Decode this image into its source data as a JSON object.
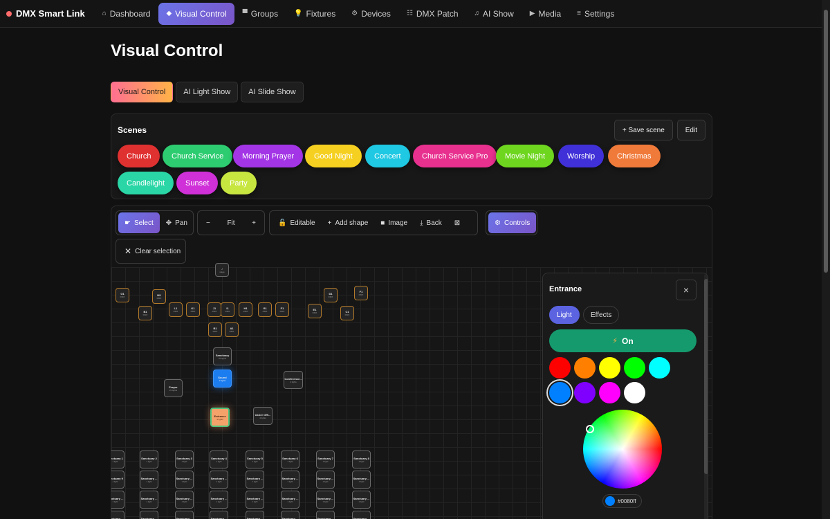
{
  "app": {
    "name": "DMX Smart Link"
  },
  "nav": [
    {
      "label": "Dashboard",
      "icon": "home-icon",
      "glyph": "⌂"
    },
    {
      "label": "Visual Control",
      "icon": "diamond-icon",
      "glyph": "◆",
      "active": true
    },
    {
      "label": "Groups",
      "icon": "groups-icon",
      "glyph": "▀"
    },
    {
      "label": "Fixtures",
      "icon": "bulb-icon",
      "glyph": "💡"
    },
    {
      "label": "Devices",
      "icon": "gear-icon",
      "glyph": "⚙"
    },
    {
      "label": "DMX Patch",
      "icon": "patch-icon",
      "glyph": "☷"
    },
    {
      "label": "AI Show",
      "icon": "music-icon",
      "glyph": "♫"
    },
    {
      "label": "Media",
      "icon": "play-icon",
      "glyph": "▶"
    },
    {
      "label": "Settings",
      "icon": "menu-icon",
      "glyph": "≡"
    }
  ],
  "page": {
    "title": "Visual Control"
  },
  "mode_tabs": [
    {
      "label": "Visual Control",
      "active": true
    },
    {
      "label": "AI Light Show"
    },
    {
      "label": "AI Slide Show"
    }
  ],
  "scenes": {
    "title": "Scenes",
    "save_label": "+ Save scene",
    "edit_label": "Edit",
    "items": [
      {
        "label": "Church",
        "color": "#e03131",
        "text": "#ffffff"
      },
      {
        "label": "Church Service",
        "color": "#2ecc71",
        "text": "#ffffff"
      },
      {
        "label": "Morning Prayer",
        "color": "#a335e6",
        "text": "#ffffff"
      },
      {
        "label": "Good Night",
        "color": "#f5d020",
        "text": "#ffffff"
      },
      {
        "label": "Concert",
        "color": "#1fc8e3",
        "text": "#ffffff"
      },
      {
        "label": "Church Service Pro",
        "color": "#e8308f",
        "text": "#ffffff"
      },
      {
        "label": "Movie Night",
        "color": "#6ed61f",
        "text": "#ffffff"
      },
      {
        "label": "Worship",
        "color": "#4030d8",
        "text": "#ffffff"
      },
      {
        "label": "Christmas",
        "color": "#f07a3a",
        "text": "#ffffff"
      },
      {
        "label": "Candlelight",
        "color": "#2ad6a6",
        "text": "#ffffff"
      },
      {
        "label": "Sunset",
        "color": "#d030d8",
        "text": "#ffffff"
      },
      {
        "label": "Party",
        "color": "#c8e640",
        "text": "#ffffff"
      }
    ]
  },
  "toolbar": {
    "select": "Select",
    "pan": "Pan",
    "zoom_out": "−",
    "fit": "Fit",
    "zoom_in": "+",
    "editable": "Editable",
    "add_shape": "Add shape",
    "image": "Image",
    "back": "Back",
    "controls": "Controls",
    "clear_selection": "Clear selection"
  },
  "canvas": {
    "top_node": {
      "label": "♪",
      "sub": "stage"
    },
    "fixtures": [
      {
        "label": "G1",
        "sub": "DMX"
      },
      {
        "label": "M1",
        "sub": "DMX"
      },
      {
        "label": "B1",
        "sub": "DMX"
      },
      {
        "label": "L1",
        "sub": "DMX"
      },
      {
        "label": "K1",
        "sub": "DMX"
      },
      {
        "label": "J1",
        "sub": "DMX"
      },
      {
        "label": "I1",
        "sub": "DMX"
      },
      {
        "label": "H1",
        "sub": "DMX"
      },
      {
        "label": "G1",
        "sub": "DMX"
      },
      {
        "label": "F1",
        "sub": "DMX"
      },
      {
        "label": "E1",
        "sub": "DMX"
      },
      {
        "label": "D1",
        "sub": "DMX"
      },
      {
        "label": "C1",
        "sub": "DMX"
      },
      {
        "label": "F1",
        "sub": "DMX"
      },
      {
        "label": "B1",
        "sub": "DMX"
      },
      {
        "label": "A1",
        "sub": "DMX"
      }
    ],
    "groups": [
      {
        "label": "Sanctuary",
        "sub": "20 lights"
      },
      {
        "label": "Sound",
        "sub": "2 lights"
      },
      {
        "label": "Conference...",
        "sub": "4 lights"
      },
      {
        "label": "Prayer",
        "sub": "20 lights"
      },
      {
        "label": "Entrance",
        "sub": "4 lights"
      },
      {
        "label": "Usher Offi...",
        "sub": "4 lights"
      }
    ],
    "grid_row_labels": [
      [
        "Sanctuary 1",
        "Sanctuary 2",
        "Sanctuary 3",
        "Sanctuary 4",
        "Sanctuary 5",
        "Sanctuary 6",
        "Sanctuary 7",
        "Sanctuary 8"
      ],
      [
        "Sanctuary 9",
        "Sanctuary ...",
        "Sanctuary ...",
        "Sanctuary ...",
        "Sanctuary ...",
        "Sanctuary ...",
        "Sanctuary ...",
        "Sanctuary ..."
      ],
      [
        "Sanctuary ...",
        "Sanctuary ...",
        "Sanctuary ...",
        "Sanctuary ...",
        "Sanctuary ...",
        "Sanctuary ...",
        "Sanctuary ...",
        "Sanctuary ..."
      ],
      [
        "Sanctuary ...",
        "Sanctuary ...",
        "Sanctuary ...",
        "Sanctuary ...",
        "Sanctuary ...",
        "Sanctuary ...",
        "Sanctuary ...",
        "Sanctuary ..."
      ]
    ],
    "grid_sub": "1 light"
  },
  "panel": {
    "title": "Entrance",
    "close": "×",
    "tab_light": "Light",
    "tab_effects": "Effects",
    "on_label": "On",
    "swatches": [
      "#ff0000",
      "#ff8000",
      "#ffff00",
      "#00ff00",
      "#00ffff",
      "#0080ff",
      "#8000ff",
      "#ff00ff",
      "#ffffff"
    ],
    "selected_swatch": "#0080ff",
    "hex": "#0080ff"
  }
}
